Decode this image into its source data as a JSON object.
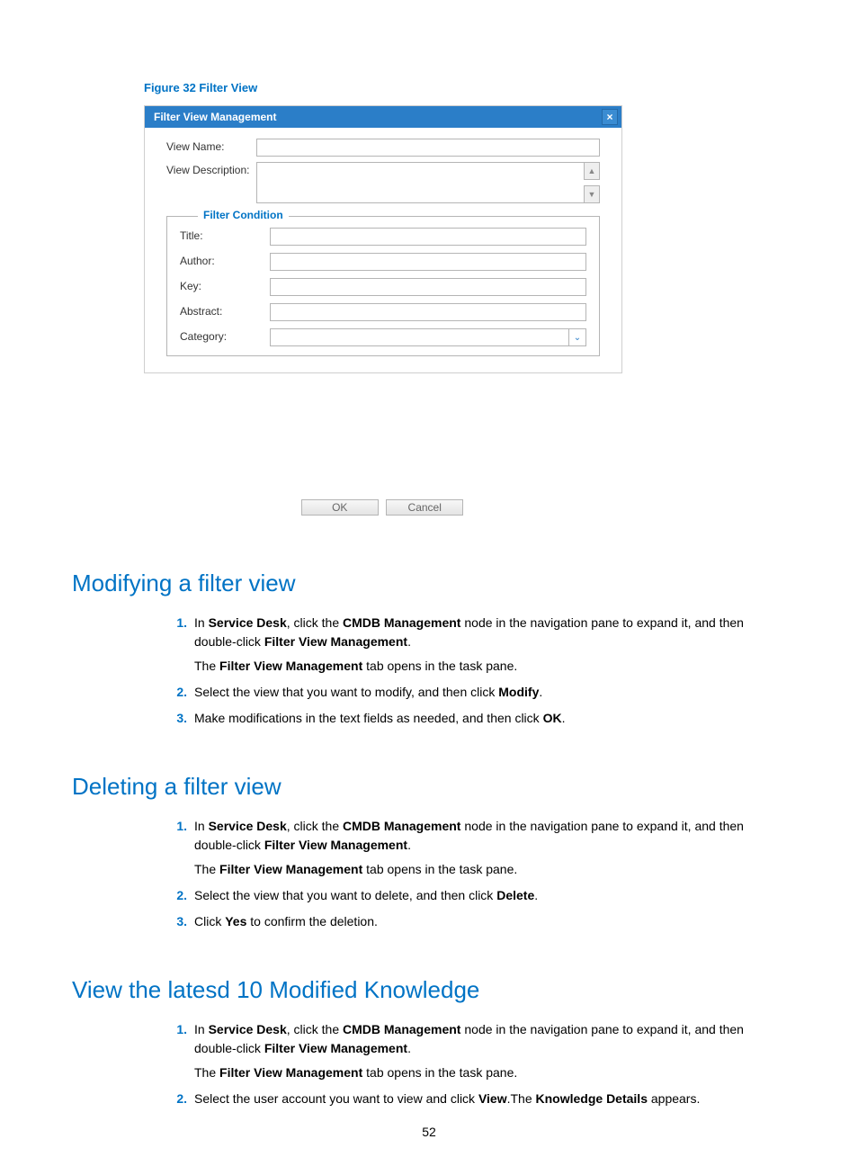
{
  "figureCaption": "Figure 32 Filter View",
  "dialog": {
    "title": "Filter View Management",
    "closeGlyph": "×",
    "labels": {
      "viewName": "View Name:",
      "viewDesc": "View Description:",
      "legend": "Filter Condition",
      "titleField": "Title:",
      "author": "Author:",
      "key": "Key:",
      "abstract": "Abstract:",
      "category": "Category:"
    },
    "scrollUp": "▲",
    "scrollDown": "▼",
    "comboArrow": "⌄",
    "buttons": {
      "ok": "OK",
      "cancel": "Cancel"
    }
  },
  "sections": {
    "modify": {
      "heading": "Modifying a filter view",
      "steps": {
        "s1a": "In ",
        "s1b": "Service Desk",
        "s1c": ", click the ",
        "s1d": "CMDB Management",
        "s1e": " node in the navigation pane to expand it, and then double-click ",
        "s1f": "Filter View Management",
        "s1g": ".",
        "s1sub_a": "The ",
        "s1sub_b": "Filter View Management",
        "s1sub_c": " tab opens in the task pane.",
        "s2a": "Select the view that you want to modify, and then click ",
        "s2b": "Modify",
        "s2c": ".",
        "s3a": "Make modifications in the text fields as needed, and then click ",
        "s3b": "OK",
        "s3c": "."
      }
    },
    "delete": {
      "heading": "Deleting a filter view",
      "steps": {
        "s1a": "In ",
        "s1b": "Service Desk",
        "s1c": ", click the ",
        "s1d": "CMDB Management",
        "s1e": " node in the navigation pane to expand it, and then double-click ",
        "s1f": "Filter View Management",
        "s1g": ".",
        "s1sub_a": "The ",
        "s1sub_b": "Filter View Management",
        "s1sub_c": " tab opens in the task pane.",
        "s2a": "Select the view that you want to delete, and then click ",
        "s2b": "Delete",
        "s2c": ".",
        "s3a": "Click ",
        "s3b": "Yes",
        "s3c": " to confirm the deletion."
      }
    },
    "latest": {
      "heading": "View the latesd 10 Modified Knowledge",
      "steps": {
        "s1a": "In ",
        "s1b": "Service Desk",
        "s1c": ", click the ",
        "s1d": "CMDB Management",
        "s1e": " node in the navigation pane to expand it, and then double-click ",
        "s1f": "Filter View Management",
        "s1g": ".",
        "s1sub_a": "The ",
        "s1sub_b": "Filter View Management",
        "s1sub_c": " tab opens in the task pane.",
        "s2a": "Select the user account you want to view and click ",
        "s2b": "View",
        "s2c": ".The ",
        "s2d": "Knowledge Details",
        "s2e": " appears."
      }
    }
  },
  "pageNumber": "52"
}
